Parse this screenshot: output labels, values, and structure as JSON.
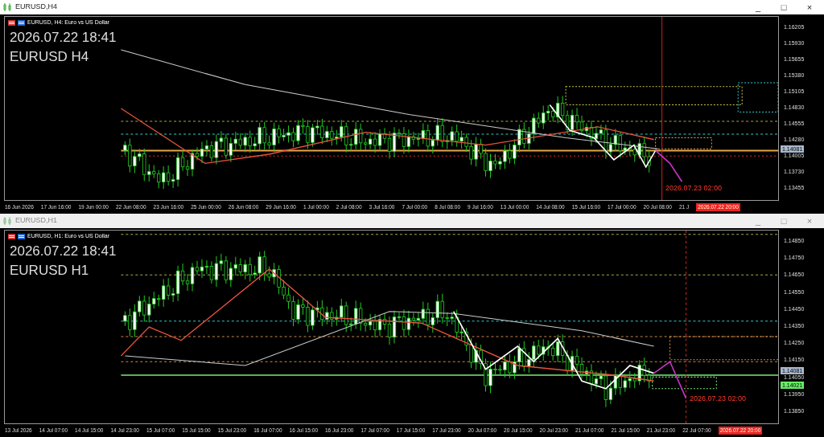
{
  "windows": [
    {
      "title": "EURUSD,H4",
      "active": true,
      "controls": [
        "_",
        "□",
        "×"
      ],
      "chart_header": "EURUSD, H4:  Euro vs US Dollar",
      "timestamp": "2026.07.22 18:41",
      "symbol_label": "EURUSD H4",
      "forecast_label": "2026.07.23 02:00",
      "price_axis": {
        "labels": [
          "1.16205",
          "1.15930",
          "1.15655",
          "1.15380",
          "1.15105",
          "1.14830",
          "1.14555",
          "1.14280",
          "1.14005",
          "1.13730",
          "1.13455"
        ],
        "badges": [
          {
            "value": "1.14081",
            "color": "#a9b8cc"
          }
        ]
      },
      "time_axis": {
        "labels": [
          "16 Jun 2026",
          "17 Jun 16:00",
          "19 Jun 00:00",
          "22 Jun 08:00",
          "23 Jun 16:00",
          "25 Jun 00:00",
          "26 Jun 08:00",
          "29 Jun 16:00",
          "1 Jul 00:00",
          "2 Jul 08:00",
          "3 Jul 16:00",
          "7 Jul 00:00",
          "8 Jul 08:00",
          "9 Jul 16:00",
          "13 Jul 00:00",
          "14 Jul 08:00",
          "15 Jul 16:00",
          "17 Jul 00:00",
          "20 Jul 08:00",
          "21 J"
        ],
        "current": "2026.07.22 20:00"
      }
    },
    {
      "title": "EURUSD,H1",
      "active": false,
      "controls": [
        "_",
        "□",
        "×"
      ],
      "chart_header": "EURUSD, H1:  Euro vs US Dollar",
      "timestamp": "2026.07.22 18:41",
      "symbol_label": "EURUSD H1",
      "forecast_label": "2026.07.23 02:00",
      "price_axis": {
        "labels": [
          "1.14850",
          "1.14750",
          "1.14650",
          "1.14550",
          "1.14450",
          "1.14350",
          "1.14250",
          "1.14150",
          "1.14050",
          "1.13950",
          "1.13850"
        ],
        "badges": [
          {
            "value": "1.14081",
            "color": "#a9b8cc"
          },
          {
            "value": "1.14021",
            "color": "#66ee66"
          }
        ]
      },
      "time_axis": {
        "labels": [
          "13 Jul 2026",
          "14 Jul 07:00",
          "14 Jul 15:00",
          "14 Jul 23:00",
          "15 Jul 07:00",
          "15 Jul 15:00",
          "15 Jul 23:00",
          "16 Jul 07:00",
          "16 Jul 15:00",
          "16 Jul 23:00",
          "17 Jul 07:00",
          "17 Jul 15:00",
          "17 Jul 23:00",
          "20 Jul 07:00",
          "20 Jul 15:00",
          "20 Jul 23:00",
          "21 Jul 07:00",
          "21 Jul 15:00",
          "21 Jul 23:00",
          "22 Jul 07:00"
        ],
        "current": "2026.07.22 20:00"
      }
    }
  ]
}
